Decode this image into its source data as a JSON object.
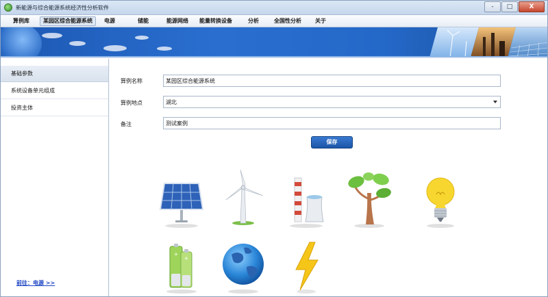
{
  "window": {
    "title": "新能源与综合能源系统经济性分析软件",
    "controls": [
      "-",
      "□",
      "X"
    ]
  },
  "menu": {
    "items": [
      {
        "label": "算例库",
        "active": false
      },
      {
        "label": "某园区综合能源系统",
        "active": true
      },
      {
        "label": "电源",
        "active": false
      },
      {
        "label": "储能",
        "active": false
      },
      {
        "label": "能源网络",
        "active": false
      },
      {
        "label": "能量转换设备",
        "active": false
      },
      {
        "label": "分析",
        "active": false
      },
      {
        "label": "全国性分析",
        "active": false
      },
      {
        "label": "关于",
        "active": false
      }
    ]
  },
  "sidebar": {
    "items": [
      {
        "label": "基础参数",
        "active": true
      },
      {
        "label": "系统设备单元组成",
        "active": false
      },
      {
        "label": "投资主体",
        "active": false
      }
    ],
    "goto_link": "前往：电源  >>"
  },
  "form": {
    "case_name": {
      "label": "算例名称",
      "value": "某园区综合能源系统"
    },
    "case_location": {
      "label": "算例地点",
      "value": "湖北"
    },
    "remarks": {
      "label": "备注",
      "value": "测试案例"
    },
    "save_label": "保存"
  },
  "icons": [
    {
      "name": "solar-panel-icon"
    },
    {
      "name": "wind-turbine-icon"
    },
    {
      "name": "power-plant-icon"
    },
    {
      "name": "biomass-tree-icon"
    },
    {
      "name": "light-bulb-icon"
    },
    {
      "name": "battery-icon"
    },
    {
      "name": "globe-icon"
    },
    {
      "name": "lightning-bolt-icon"
    }
  ],
  "colors": {
    "banner_blue": "#2468c8",
    "save_button": "#1a55a8",
    "link_blue": "#1c44c4"
  }
}
